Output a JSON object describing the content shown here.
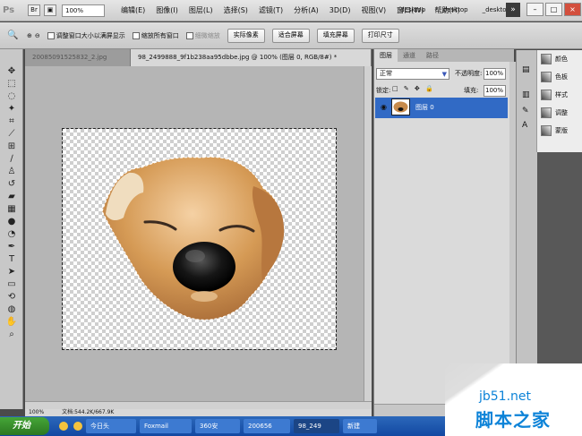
{
  "app": {
    "logo": "Ps",
    "zoom": "100%"
  },
  "menus": [
    "编辑(E)",
    "图像(I)",
    "图层(L)",
    "选择(S)",
    "滤镜(T)",
    "分析(A)",
    "3D(D)",
    "视图(V)",
    "窗口(W)",
    "帮助(H)"
  ],
  "workspaces": [
    "_desktop",
    "_desktop",
    "_desktop"
  ],
  "titlebar": {
    "expand": "»",
    "minimize": "–",
    "restore": "□",
    "close": "×"
  },
  "options": {
    "tool": "🔍",
    "checks": [
      "调整窗口大小以满屏显示",
      "缩放所有窗口",
      "细微缩放"
    ],
    "buttons": [
      "实际像素",
      "适合屏幕",
      "填充屏幕",
      "打印尺寸"
    ]
  },
  "tabs": [
    "20085091525832_2.jpg",
    "98_2499888_9f1b238aa95dbbe.jpg @ 100% (图层 0, RGB/8#) *"
  ],
  "status": {
    "zoom": "100%",
    "doc": "文档:544.2K/667.9K"
  },
  "layers": {
    "tabs": [
      "图层",
      "通道",
      "路径"
    ],
    "blend_mode": "正常",
    "opacity_label": "不透明度:",
    "opacity": "100%",
    "lock_label": "锁定:",
    "fill_label": "填充:",
    "fill": "100%",
    "layer_name": "图层 0"
  },
  "mini_panels": [
    "颜色",
    "色板",
    "样式",
    "调整",
    "蒙版"
  ],
  "taskbar": {
    "start": "开始",
    "items": [
      "今日头",
      "Foxmail",
      "360安",
      "200656",
      "98_249",
      "新建"
    ]
  },
  "watermark": {
    "site": "jb51.net",
    "name": "脚本之家"
  }
}
